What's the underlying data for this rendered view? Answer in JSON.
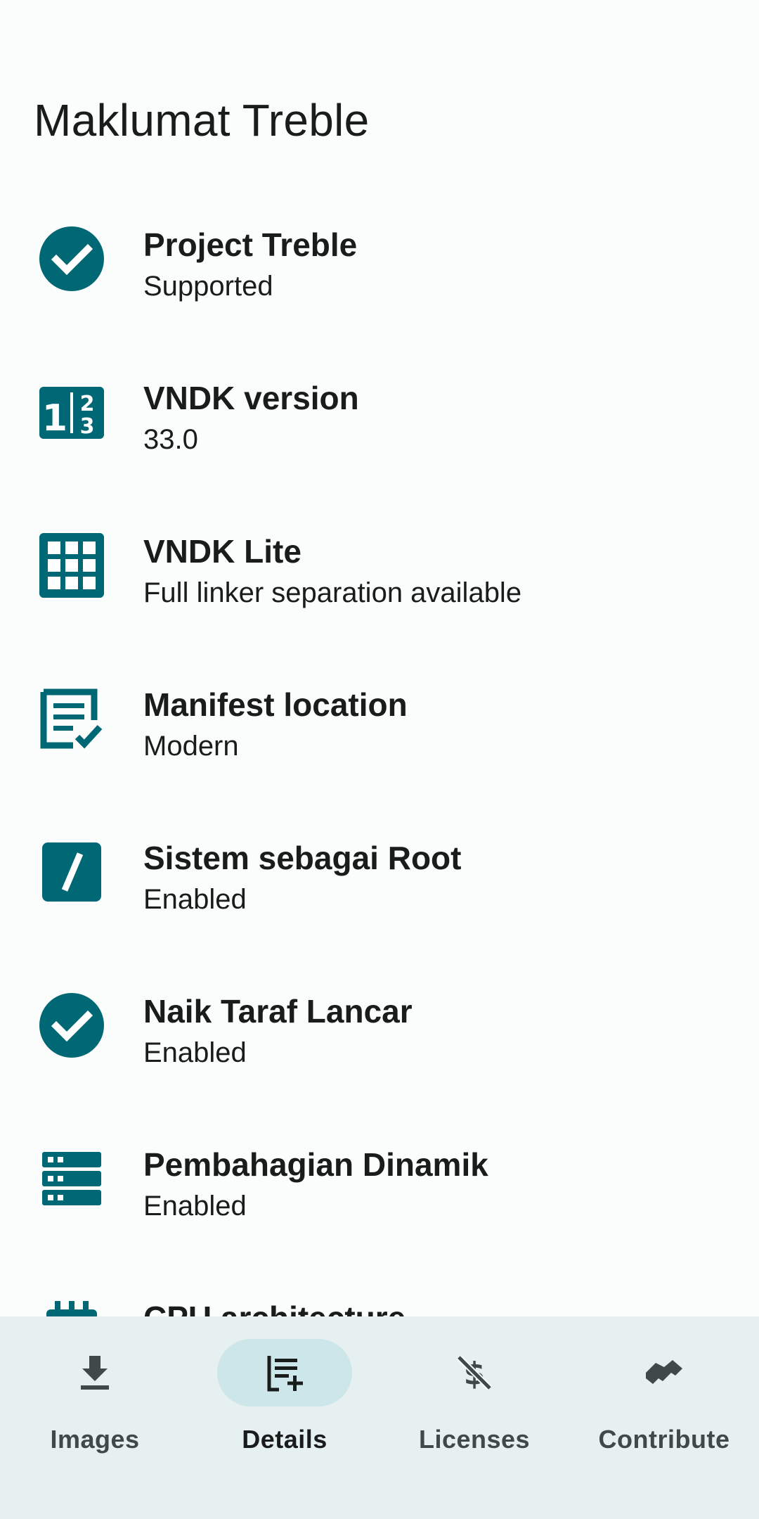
{
  "header": {
    "title": "Maklumat Treble"
  },
  "colors": {
    "accent": "#006874",
    "nav_bg": "#e6f0f0",
    "nav_active_pill": "#cce6ea"
  },
  "items": [
    {
      "icon": "check-circle-icon",
      "title": "Project Treble",
      "value": "Supported"
    },
    {
      "icon": "numbers-icon",
      "title": "VNDK version",
      "value": "33.0"
    },
    {
      "icon": "grid-icon",
      "title": "VNDK Lite",
      "value": "Full linker separation available"
    },
    {
      "icon": "manifest-check-icon",
      "title": "Manifest location",
      "value": "Modern"
    },
    {
      "icon": "slash-square-icon",
      "title": "Sistem sebagai Root",
      "value": "Enabled"
    },
    {
      "icon": "check-circle-icon",
      "title": "Naik Taraf Lancar",
      "value": "Enabled"
    },
    {
      "icon": "storage-icon",
      "title": "Pembahagian Dinamik",
      "value": "Enabled"
    },
    {
      "icon": "memory-icon",
      "title": "CPU architecture",
      "value": ""
    }
  ],
  "nav": [
    {
      "icon": "download-icon",
      "label": "Images",
      "active": false
    },
    {
      "icon": "playlist-add-icon",
      "label": "Details",
      "active": true
    },
    {
      "icon": "money-off-icon",
      "label": "Licenses",
      "active": false
    },
    {
      "icon": "handshake-icon",
      "label": "Contribute",
      "active": false
    }
  ]
}
